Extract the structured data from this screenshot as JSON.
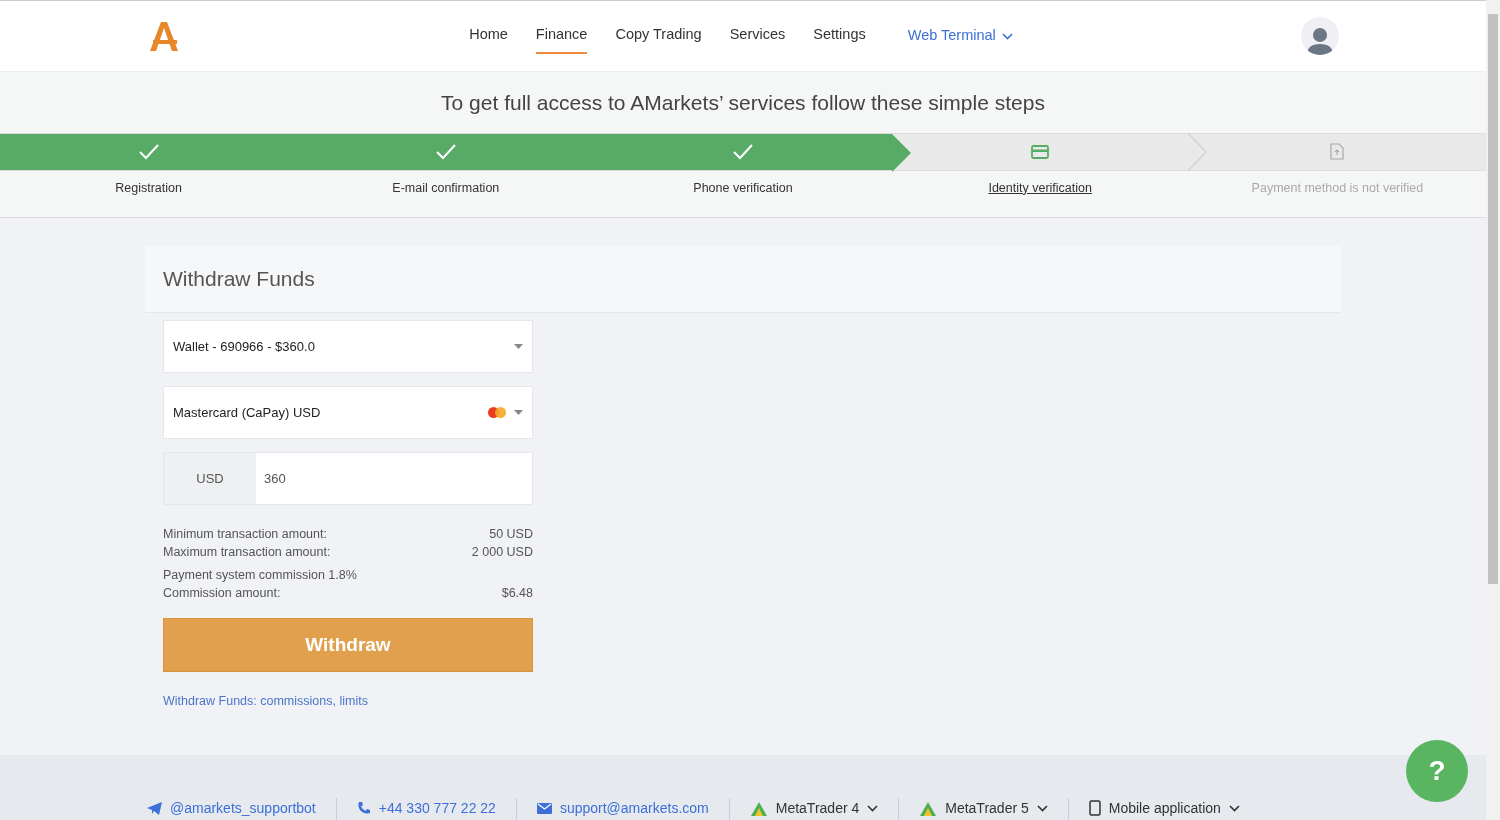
{
  "nav": {
    "items": [
      {
        "label": "Home",
        "selected": false
      },
      {
        "label": "Finance",
        "selected": true
      },
      {
        "label": "Copy Trading",
        "selected": false
      },
      {
        "label": "Services",
        "selected": false
      },
      {
        "label": "Settings",
        "selected": false
      }
    ],
    "terminal": "Web Terminal"
  },
  "steps_title": "To get full access to AMarkets’ services follow these simple steps",
  "steps": [
    {
      "label": "Registration",
      "completed": true,
      "selected": false
    },
    {
      "label": "E-mail confirmation",
      "completed": true,
      "selected": false
    },
    {
      "label": "Phone verification",
      "completed": true,
      "selected": false
    },
    {
      "label": "Identity verification",
      "completed": false,
      "selected": true
    },
    {
      "label": "Payment method is not verified",
      "completed": false,
      "selected": false
    }
  ],
  "form": {
    "title": "Withdraw Funds",
    "account": "Wallet - 690966 - $360.0",
    "method": "Mastercard (CaPay) USD",
    "currency": "USD",
    "amount": "360",
    "info": [
      {
        "label": "Minimum transaction amount:",
        "value": "50 USD"
      },
      {
        "label": "Maximum transaction amount:",
        "value": "2 000 USD"
      },
      {
        "label": "Payment system commission 1.8%"
      },
      {
        "label": "Commission amount:",
        "value": "$6.48"
      }
    ],
    "submit": "Withdraw",
    "link": "Withdraw Funds: commissions, limits"
  },
  "footer": [
    {
      "kind": "telegram",
      "label": "@amarkets_supportbot"
    },
    {
      "kind": "phone",
      "label": "+44 330 777 22 22"
    },
    {
      "kind": "mail",
      "label": "support@amarkets.com"
    },
    {
      "kind": "metatrader",
      "label": "MetaTrader 4"
    },
    {
      "kind": "metatrader",
      "label": "MetaTrader 5"
    },
    {
      "kind": "mobile",
      "label": "Mobile application"
    }
  ],
  "help_button": "?"
}
